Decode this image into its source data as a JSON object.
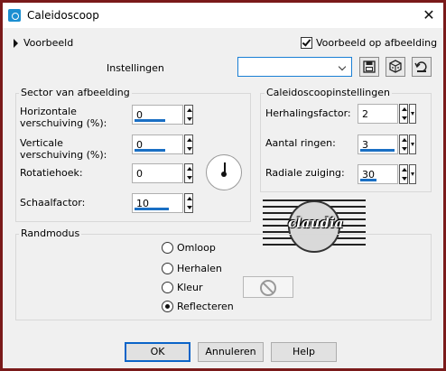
{
  "window": {
    "title": "Caleidoscoop",
    "close": "✕"
  },
  "top": {
    "preview_label": "Voorbeeld",
    "preview_checkbox_label": "Voorbeeld op afbeelding",
    "preview_checked": true,
    "settings_label": "Instellingen",
    "settings_value": ""
  },
  "sector": {
    "title": "Sector van afbeelding",
    "fields": [
      {
        "label_line1": "Horizontale",
        "label_line2": "verschuiving (%):",
        "value": "0"
      },
      {
        "label_line1": "Verticale",
        "label_line2": "verschuiving (%):",
        "value": "0"
      },
      {
        "label_line1": "Rotatiehoek:",
        "label_line2": "",
        "value": "0"
      },
      {
        "label_line1": "Schaalfactor:",
        "label_line2": "",
        "value": "10"
      }
    ]
  },
  "kaleido": {
    "title": "Caleidoscoopinstellingen",
    "fields": [
      {
        "label": "Herhalingsfactor:",
        "value": "2"
      },
      {
        "label": "Aantal ringen:",
        "value": "3"
      },
      {
        "label": "Radiale zuiging:",
        "value": "30"
      }
    ]
  },
  "edge": {
    "title": "Randmodus",
    "options": [
      "Omloop",
      "Herhalen",
      "Kleur",
      "Reflecteren"
    ],
    "selected": "Reflecteren"
  },
  "watermark": {
    "text": "claudia"
  },
  "buttons": {
    "ok": "OK",
    "cancel": "Annuleren",
    "help": "Help"
  },
  "colors": {
    "accent": "#1a6fc4",
    "frame": "#7a1a1a",
    "dialog_bg": "#f0f0f0"
  }
}
